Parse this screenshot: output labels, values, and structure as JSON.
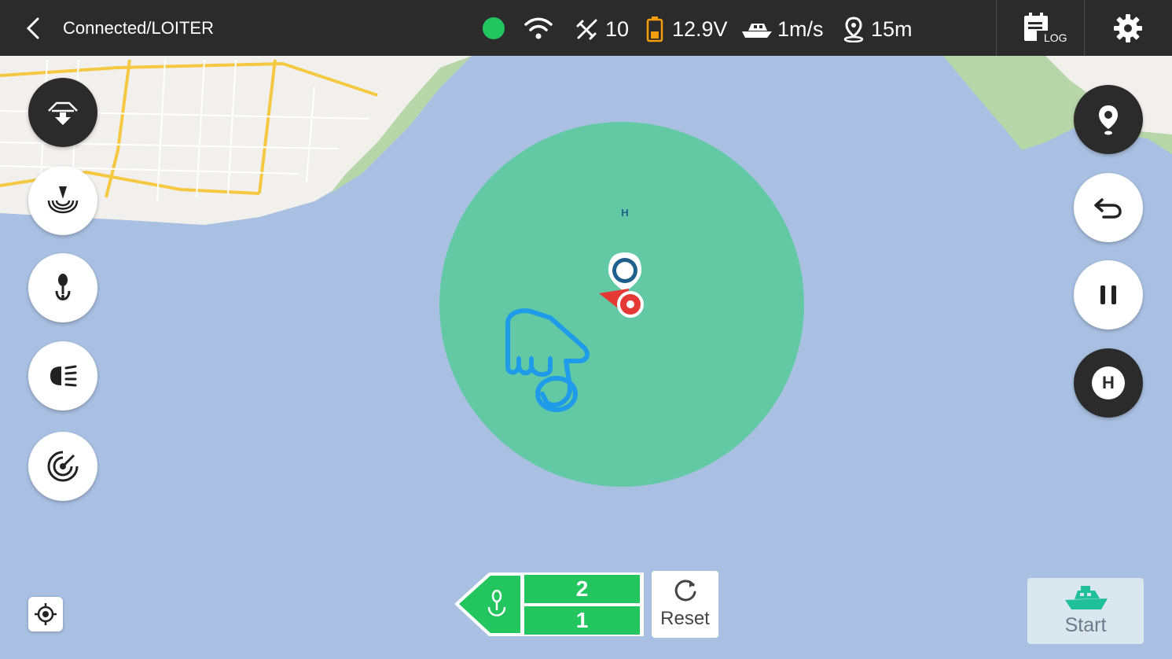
{
  "topbar": {
    "status": "Connected/LOITER",
    "satellites": "10",
    "voltage": "12.9V",
    "speed": "1m/s",
    "distance": "15m",
    "log_label": "LOG"
  },
  "colors": {
    "topbar_bg": "#2b2b2b",
    "water": "#a9c0e2",
    "zone": "#63c9a5",
    "connected_dot": "#22c55e",
    "battery": "#f59e0b",
    "hand": "#1e9be9",
    "boat_marker": "#e53935",
    "home_marker": "#1f5f8b",
    "bait_panel": "#22c55e"
  },
  "map": {
    "home_marker_label": "H"
  },
  "right_buttons": {
    "home_label": "H"
  },
  "bottom": {
    "bait_slot_top": "2",
    "bait_slot_bottom": "1",
    "reset_label": "Reset",
    "start_label": "Start"
  }
}
